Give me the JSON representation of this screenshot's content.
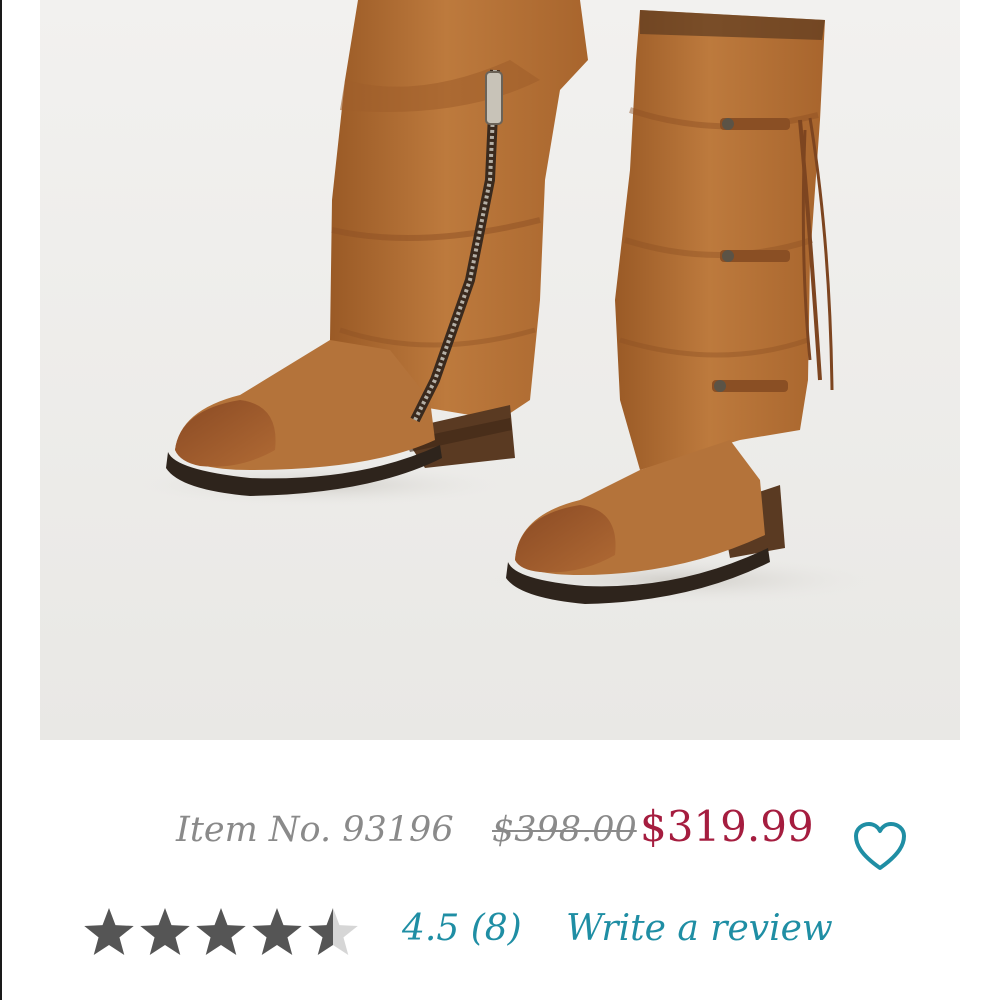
{
  "product": {
    "image_alt": "Suede knee-high boots",
    "item_number": "Item No. 93196",
    "original_price": "$398.00",
    "sale_price": "$319.99",
    "wishlist_icon": "heart-outline-icon"
  },
  "rating": {
    "score": 4.5,
    "max": 5,
    "score_text": "4.5 (8)",
    "write_review_label": "Write a review"
  },
  "colors": {
    "sale_price": "#a51d3f",
    "link_teal": "#1f8ea4",
    "muted_gray": "#8a8a8a",
    "star_filled": "#555555",
    "star_empty": "#d6d6d6"
  }
}
